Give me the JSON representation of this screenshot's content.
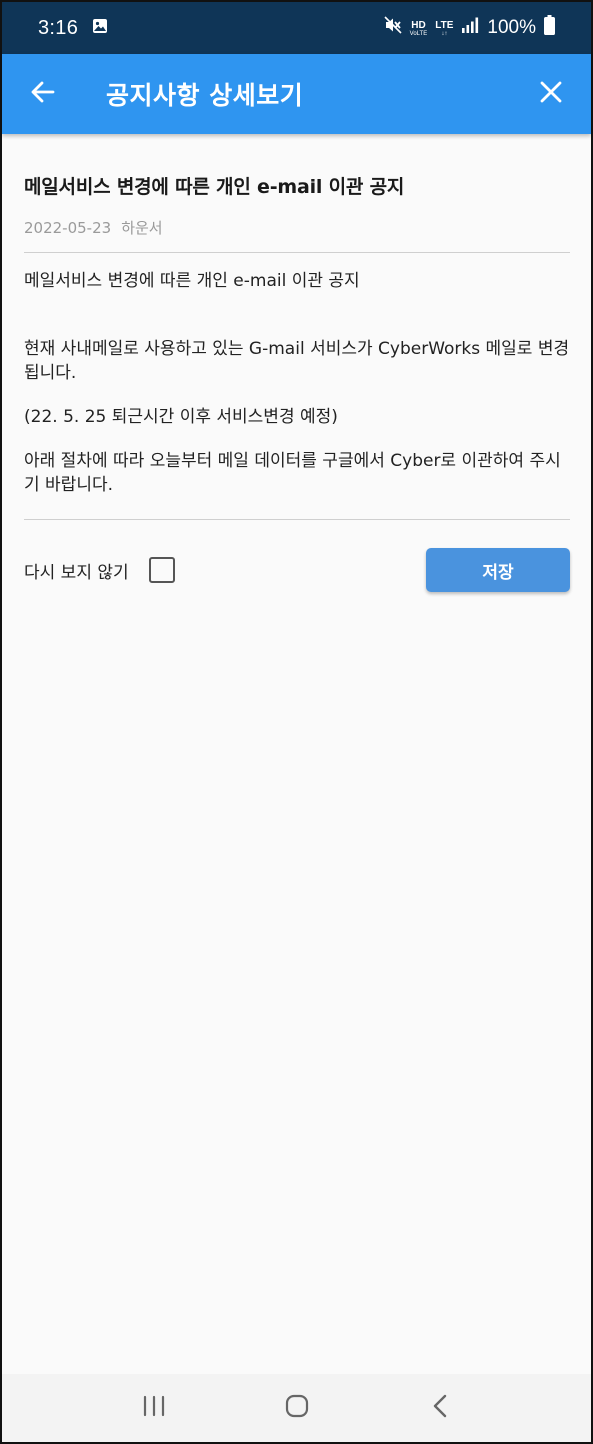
{
  "status_bar": {
    "time": "3:16",
    "network_hd": "HD",
    "network_voice": "VoLTE",
    "network_lte": "LTE",
    "battery": "100%",
    "icons": [
      "gallery-icon",
      "mute-icon",
      "signal-icon",
      "battery-icon"
    ]
  },
  "app_bar": {
    "title": "공지사항 상세보기",
    "back_icon": "arrow-left-icon",
    "close_icon": "close-icon",
    "color": "#2f95f0"
  },
  "notice": {
    "title": "메일서비스 변경에 따른 개인 e-mail 이관 공지",
    "date": "2022-05-23",
    "author": "하운서",
    "body": {
      "line1": "메일서비스 변경에 따른 개인 e-mail 이관 공지",
      "para2": "현재 사내메일로 사용하고 있는 G-mail 서비스가 CyberWorks 메일로 변경됩니다.",
      "para3": "(22. 5. 25 퇴근시간 이후 서비스변경 예정)",
      "para4": "아래 절차에 따라 오늘부터 메일 데이터를 구글에서 Cyber로 이관하여 주시기 바랍니다."
    }
  },
  "footer": {
    "dont_show_label": "다시 보지 않기",
    "dont_show_checked": false,
    "save_label": "저장",
    "save_color": "#4a93de"
  },
  "nav_bar": {
    "icons": [
      "recent-apps-icon",
      "home-icon",
      "back-icon"
    ]
  }
}
